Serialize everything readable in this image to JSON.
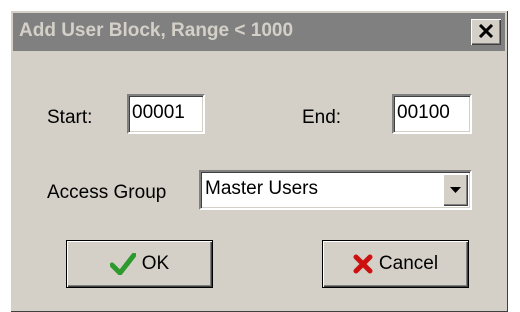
{
  "window": {
    "title": "Add User Block, Range < 1000",
    "close_glyph": "X"
  },
  "form": {
    "start_label": "Start:",
    "start_value": "00001",
    "end_label": "End:",
    "end_value": "00100",
    "access_group_label": "Access Group",
    "access_group_value": "Master Users"
  },
  "buttons": {
    "ok_label": "OK",
    "ok_icon": "checkmark-icon",
    "cancel_label": "Cancel",
    "cancel_icon": "red-x-icon"
  },
  "colors": {
    "titlebar_inactive": "#808080",
    "dialog_face": "#d4d0c8",
    "ok_icon": "#2e9a2e",
    "cancel_icon": "#cc1010"
  }
}
